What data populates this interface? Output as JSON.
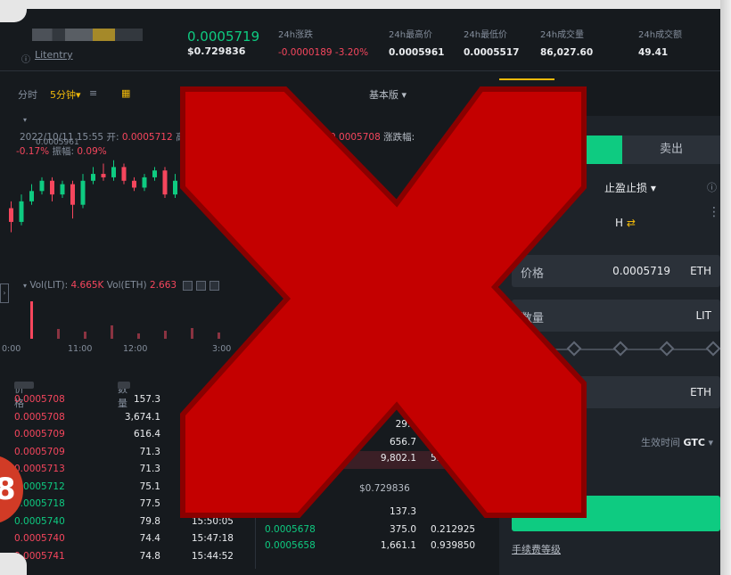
{
  "header": {
    "pair_subtitle": "Litentry",
    "last_price": "0.0005719",
    "last_price_usd": "$0.729836",
    "stats": [
      {
        "label": "24h涨跌",
        "value": "-0.0000189 -3.20%"
      },
      {
        "label": "24h最高价",
        "value": "0.0005961"
      },
      {
        "label": "24h最低价",
        "value": "0.0005517"
      },
      {
        "label": "24h成交量",
        "value": "86,027.60"
      },
      {
        "label": "24h成交额",
        "value": "49.41"
      }
    ]
  },
  "toolbar": {
    "time_label": "分时",
    "interval_label": "5分钟",
    "basic_label": "基本版"
  },
  "chart": {
    "info_line1_prefix": "2022/10/11 15:55 开: ",
    "info_line1_open": "0.0005712",
    "info_line1_tail": "高",
    "info_line2_change": "-0.17%",
    "info_line2_amp_label": "振幅: ",
    "info_line2_amp": "0.09%",
    "top_price_label": "0.0005961",
    "float_quote_price": "0.0005708",
    "float_quote_label": "涨跌幅:",
    "vol_label": "Vol(LIT): ",
    "vol_lit": "4.665K",
    "vol_eth_label": "Vol(ETH)",
    "vol_eth": "2.663",
    "time_axis": [
      "0:00",
      "11:00",
      "12:00",
      "3:00"
    ]
  },
  "chart_data": {
    "type": "bar",
    "title": "",
    "candles": [
      {
        "o": 0.00057,
        "c": 0.000566,
        "h": 0.000572,
        "l": 0.000563
      },
      {
        "o": 0.000566,
        "c": 0.000572,
        "h": 0.000574,
        "l": 0.000565
      },
      {
        "o": 0.000572,
        "c": 0.000575,
        "h": 0.000577,
        "l": 0.000571
      },
      {
        "o": 0.000575,
        "c": 0.000578,
        "h": 0.000579,
        "l": 0.000574
      },
      {
        "o": 0.000578,
        "c": 0.000574,
        "h": 0.000579,
        "l": 0.000572
      },
      {
        "o": 0.000574,
        "c": 0.000577,
        "h": 0.000578,
        "l": 0.000573
      },
      {
        "o": 0.000577,
        "c": 0.000571,
        "h": 0.000578,
        "l": 0.000567
      },
      {
        "o": 0.000571,
        "c": 0.000578,
        "h": 0.00058,
        "l": 0.00057
      },
      {
        "o": 0.000578,
        "c": 0.00058,
        "h": 0.000582,
        "l": 0.000577
      },
      {
        "o": 0.00058,
        "c": 0.000579,
        "h": 0.000583,
        "l": 0.000578
      },
      {
        "o": 0.000579,
        "c": 0.000582,
        "h": 0.000584,
        "l": 0.000578
      },
      {
        "o": 0.000582,
        "c": 0.000578,
        "h": 0.000583,
        "l": 0.000577
      },
      {
        "o": 0.000578,
        "c": 0.000576,
        "h": 0.000579,
        "l": 0.000575
      },
      {
        "o": 0.000576,
        "c": 0.000579,
        "h": 0.00058,
        "l": 0.000575
      },
      {
        "o": 0.000579,
        "c": 0.000581,
        "h": 0.000582,
        "l": 0.000578
      },
      {
        "o": 0.000581,
        "c": 0.000574,
        "h": 0.000582,
        "l": 0.000573
      },
      {
        "o": 0.000574,
        "c": 0.000578,
        "h": 0.00058,
        "l": 0.000573
      },
      {
        "o": 0.000578,
        "c": 0.000577,
        "h": 0.000579,
        "l": 0.000575
      }
    ],
    "volumes": [
      4.2,
      1.1,
      0.8,
      1.5,
      0.6,
      0.9,
      1.2,
      0.7
    ]
  },
  "orderbook": {
    "head_price": "价格",
    "head_qty": "数量",
    "rows": [
      {
        "price": "0.0005708",
        "qty": "157.3",
        "time": "",
        "side": "red"
      },
      {
        "price": "0.0005708",
        "qty": "3,674.1",
        "time": "",
        "side": "red"
      },
      {
        "price": "0.0005709",
        "qty": "616.4",
        "time": "",
        "side": "red"
      },
      {
        "price": "0.0005709",
        "qty": "71.3",
        "time": "",
        "side": "red"
      },
      {
        "price": "0.0005713",
        "qty": "71.3",
        "time": "",
        "side": "red"
      },
      {
        "price": "0.0005712",
        "qty": "75.1",
        "time": "",
        "side": "green"
      },
      {
        "price": "0.0005718",
        "qty": "77.5",
        "time": "",
        "side": "green"
      },
      {
        "price": "0.0005740",
        "qty": "79.8",
        "time": "15:50:05",
        "side": "green"
      },
      {
        "price": "0.0005740",
        "qty": "74.4",
        "time": "15:47:18",
        "side": "red"
      },
      {
        "price": "0.0005741",
        "qty": "74.8",
        "time": "15:44:52",
        "side": "red"
      }
    ]
  },
  "midbook": {
    "rows": [
      {
        "price": "",
        "qty": "29.2",
        "total": ""
      },
      {
        "price": "",
        "qty": "656.7",
        "total": ""
      },
      {
        "price": "",
        "qty": "9,802.1",
        "total": "5.6"
      },
      {
        "price": "",
        "qty": "137.3",
        "total": ""
      },
      {
        "price": "0.0005678",
        "qty": "375.0",
        "total": "0.212925"
      },
      {
        "price": "0.0005658",
        "qty": "1,661.1",
        "total": "0.939850"
      }
    ],
    "usd": "$0.729836"
  },
  "trade": {
    "sell_label": "卖出",
    "stoploss_label": "止盈止损",
    "swap_suffix": "H",
    "price_label": "价格",
    "price_value": "0.0005719",
    "price_unit": "ETH",
    "qty_label": "数量",
    "qty_unit": "LIT",
    "total_unit": "ETH",
    "gtc_label": "生效时间 ",
    "gtc_value": "GTC",
    "fee_link": "手续费等级"
  },
  "badge_text": "8",
  "colors": {
    "green": "#0ecb81",
    "red": "#f6465d",
    "gold": "#f0b90b",
    "overlay": "#c40000"
  }
}
